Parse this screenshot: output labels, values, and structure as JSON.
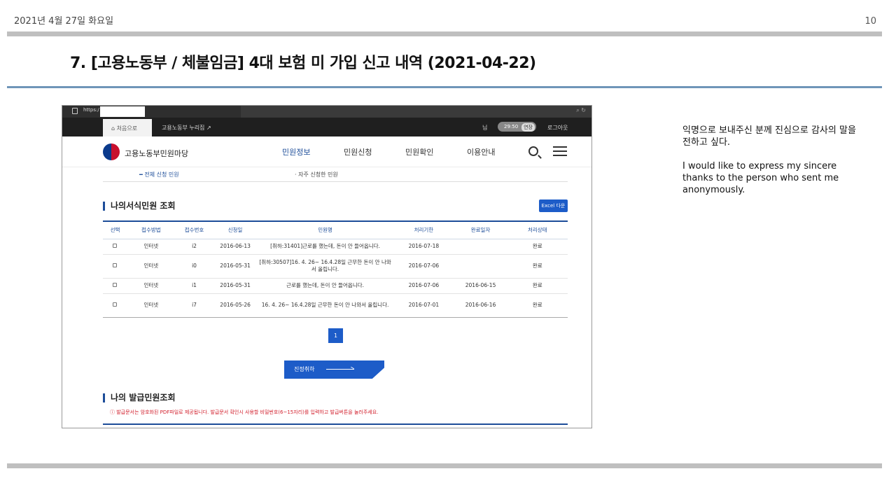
{
  "slide": {
    "date": "2021년 4월 27일 화요일",
    "page_number": "10",
    "title": "7. [고용노동부 / 체불임금] 4대 보험 미 가입 신고 내역 (2021-04-22)",
    "note_ko": "익명으로 보내주신 분께 진심으로 감사의 말을 전하고 싶다.",
    "note_en": "I would like to express my sincere thanks to the person who sent me anonymously."
  },
  "browser": {
    "url_prefix": "https:/",
    "tab_home": "처음으로",
    "tab_2": "고용노동부 누리집 ↗",
    "user_suffix": "님",
    "timer": "29:50",
    "extend": "연장",
    "logout": "로그아웃"
  },
  "site": {
    "logo_text": "고용노동부민원마당",
    "nav": [
      "민원정보",
      "민원신청",
      "민원확인",
      "이용안내"
    ],
    "subnav_1": "전체 신청 민원",
    "subnav_2": "자주 신청한 민원"
  },
  "section1": {
    "title": "나의서식민원 조회",
    "excel_button": "Excel 다운"
  },
  "table": {
    "headers": [
      "선택",
      "접수방법",
      "접수번호",
      "신청일",
      "민원명",
      "처리기한",
      "완료일자",
      "처리상태"
    ],
    "rows": [
      {
        "method": "인터넷",
        "no": "i2",
        "applied": "2016-06-13",
        "name": "[취하:31401]근로를 했는데, 돈이 안 들어옵니다.",
        "deadline": "2016-07-18",
        "done": "",
        "status": "완료"
      },
      {
        "method": "인터넷",
        "no": "i0",
        "applied": "2016-05-31",
        "name": "[취하:30507]16. 4. 26~ 16.4.28일 근무한 돈이 안 나와서 올립니다.",
        "deadline": "2016-07-06",
        "done": "",
        "status": "완료"
      },
      {
        "method": "인터넷",
        "no": "i1",
        "applied": "2016-05-31",
        "name": "근로를 했는데, 돈이 안 들어옵니다.",
        "deadline": "2016-07-06",
        "done": "2016-06-15",
        "status": "완료"
      },
      {
        "method": "인터넷",
        "no": "i7",
        "applied": "2016-05-26",
        "name": "16. 4. 26~ 16.4.28일 근무한 돈이 안 나와서 올립니다.",
        "deadline": "2016-07-01",
        "done": "2016-06-16",
        "status": "완료"
      }
    ]
  },
  "pager": {
    "current": "1"
  },
  "cta": {
    "label": "진정취하"
  },
  "section2": {
    "title": "나의 발급민원조회",
    "warning": "ⓘ 발급문서는 암호화된 PDF파일로 제공됩니다. 발급문서 확인시 사용할 비밀번호(6~15자리)를 입력하고 발급버튼을 눌러주세요."
  }
}
